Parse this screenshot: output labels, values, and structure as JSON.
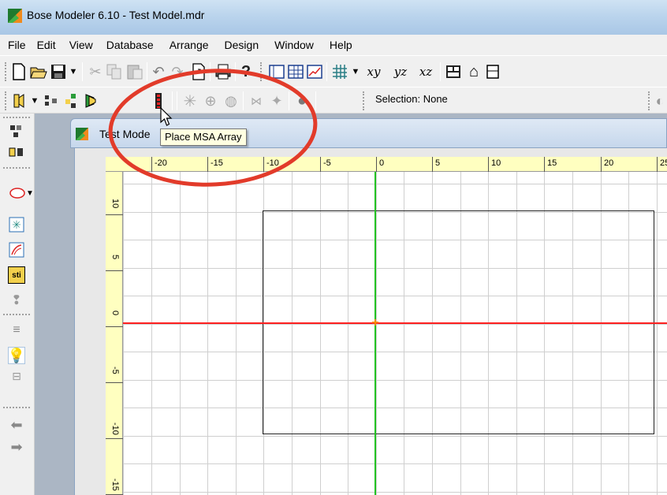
{
  "window": {
    "title": "Bose Modeler 6.10 - Test Model.mdr"
  },
  "menu": [
    "File",
    "Edit",
    "View",
    "Database",
    "Arrange",
    "Design",
    "Window",
    "Help"
  ],
  "toolbar1": {
    "icons": [
      "new-file-icon",
      "open-folder-icon",
      "save-icon",
      "dropdown-icon",
      "cut-icon",
      "copy-icon",
      "paste-icon",
      "undo-icon",
      "redo-icon",
      "export-icon",
      "print-icon",
      "help-icon",
      "window-view-icon",
      "table-view-icon",
      "chart-view-icon",
      "grid-icon",
      "dropdown-icon",
      "view-xy-icon",
      "view-yz-icon",
      "view-xz-icon",
      "box-icon",
      "house-icon"
    ],
    "view_xy": "xy",
    "view_yz": "yz",
    "view_xz": "xz"
  },
  "toolbar2": {
    "selection_label": "Selection: None"
  },
  "child_window": {
    "title": "Test Mode"
  },
  "tooltip": {
    "text": "Place MSA Array"
  },
  "ruler_top": [
    "-20",
    "-15",
    "-10",
    "-5",
    "0",
    "5",
    "10",
    "15",
    "20",
    "25"
  ],
  "ruler_left": [
    "10",
    "5",
    "0",
    "-5",
    "-10",
    "-15"
  ],
  "left_toolbar": {
    "sti_label": "sti"
  },
  "colors": {
    "x_axis": "#ff2020",
    "y_axis": "#22c322",
    "annotation": "#e23b2a",
    "ruler": "#ffffc0",
    "tooltip_bg": "#ffffe1"
  }
}
